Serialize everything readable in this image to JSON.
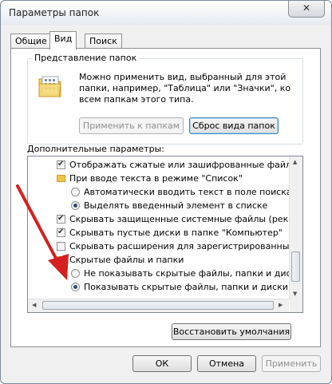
{
  "window": {
    "title": "Параметры папок",
    "close_glyph": "✕"
  },
  "tabs": [
    {
      "label": "Общие",
      "active": false
    },
    {
      "label": "Вид",
      "active": true
    },
    {
      "label": "Поиск",
      "active": false
    }
  ],
  "folder_view": {
    "legend": "Представление папок",
    "description": "Можно применить вид, выбранный для этой папки, например, \"Таблица\" или \"Значки\", ко всем папкам этого типа.",
    "apply_button": "Применить к папкам",
    "reset_button": "Сброс вида папок"
  },
  "advanced": {
    "label": "Дополнительные параметры:",
    "items": [
      {
        "type": "checkbox",
        "checked": true,
        "label": "Отображать сжатые или зашифрованные файлы NTFS"
      },
      {
        "type": "folder",
        "label": "При вводе текста в режиме \"Список\""
      },
      {
        "type": "radio",
        "selected": false,
        "label": "Автоматически вводить текст в поле поиска"
      },
      {
        "type": "radio",
        "selected": true,
        "label": "Выделять введенный элемент в списке"
      },
      {
        "type": "checkbox",
        "checked": true,
        "label": "Скрывать защищенные системные файлы (рекомендуется)"
      },
      {
        "type": "checkbox",
        "checked": true,
        "label": "Скрывать пустые диски в папке \"Компьютер\""
      },
      {
        "type": "checkbox",
        "checked": false,
        "label": "Скрывать расширения для зарегистрированных типов файлов"
      },
      {
        "type": "folder",
        "label": "Скрытые файлы и папки"
      },
      {
        "type": "radio",
        "selected": false,
        "label": "Не показывать скрытые файлы, папки и диски"
      },
      {
        "type": "radio",
        "selected": true,
        "label": "Показывать скрытые файлы, папки и диски"
      }
    ]
  },
  "restore_button": "Восстановить умолчания",
  "footer": {
    "ok": "ОК",
    "cancel": "Отмена",
    "apply": "Применить"
  },
  "colors": {
    "annotation_arrow": "#d42020"
  }
}
